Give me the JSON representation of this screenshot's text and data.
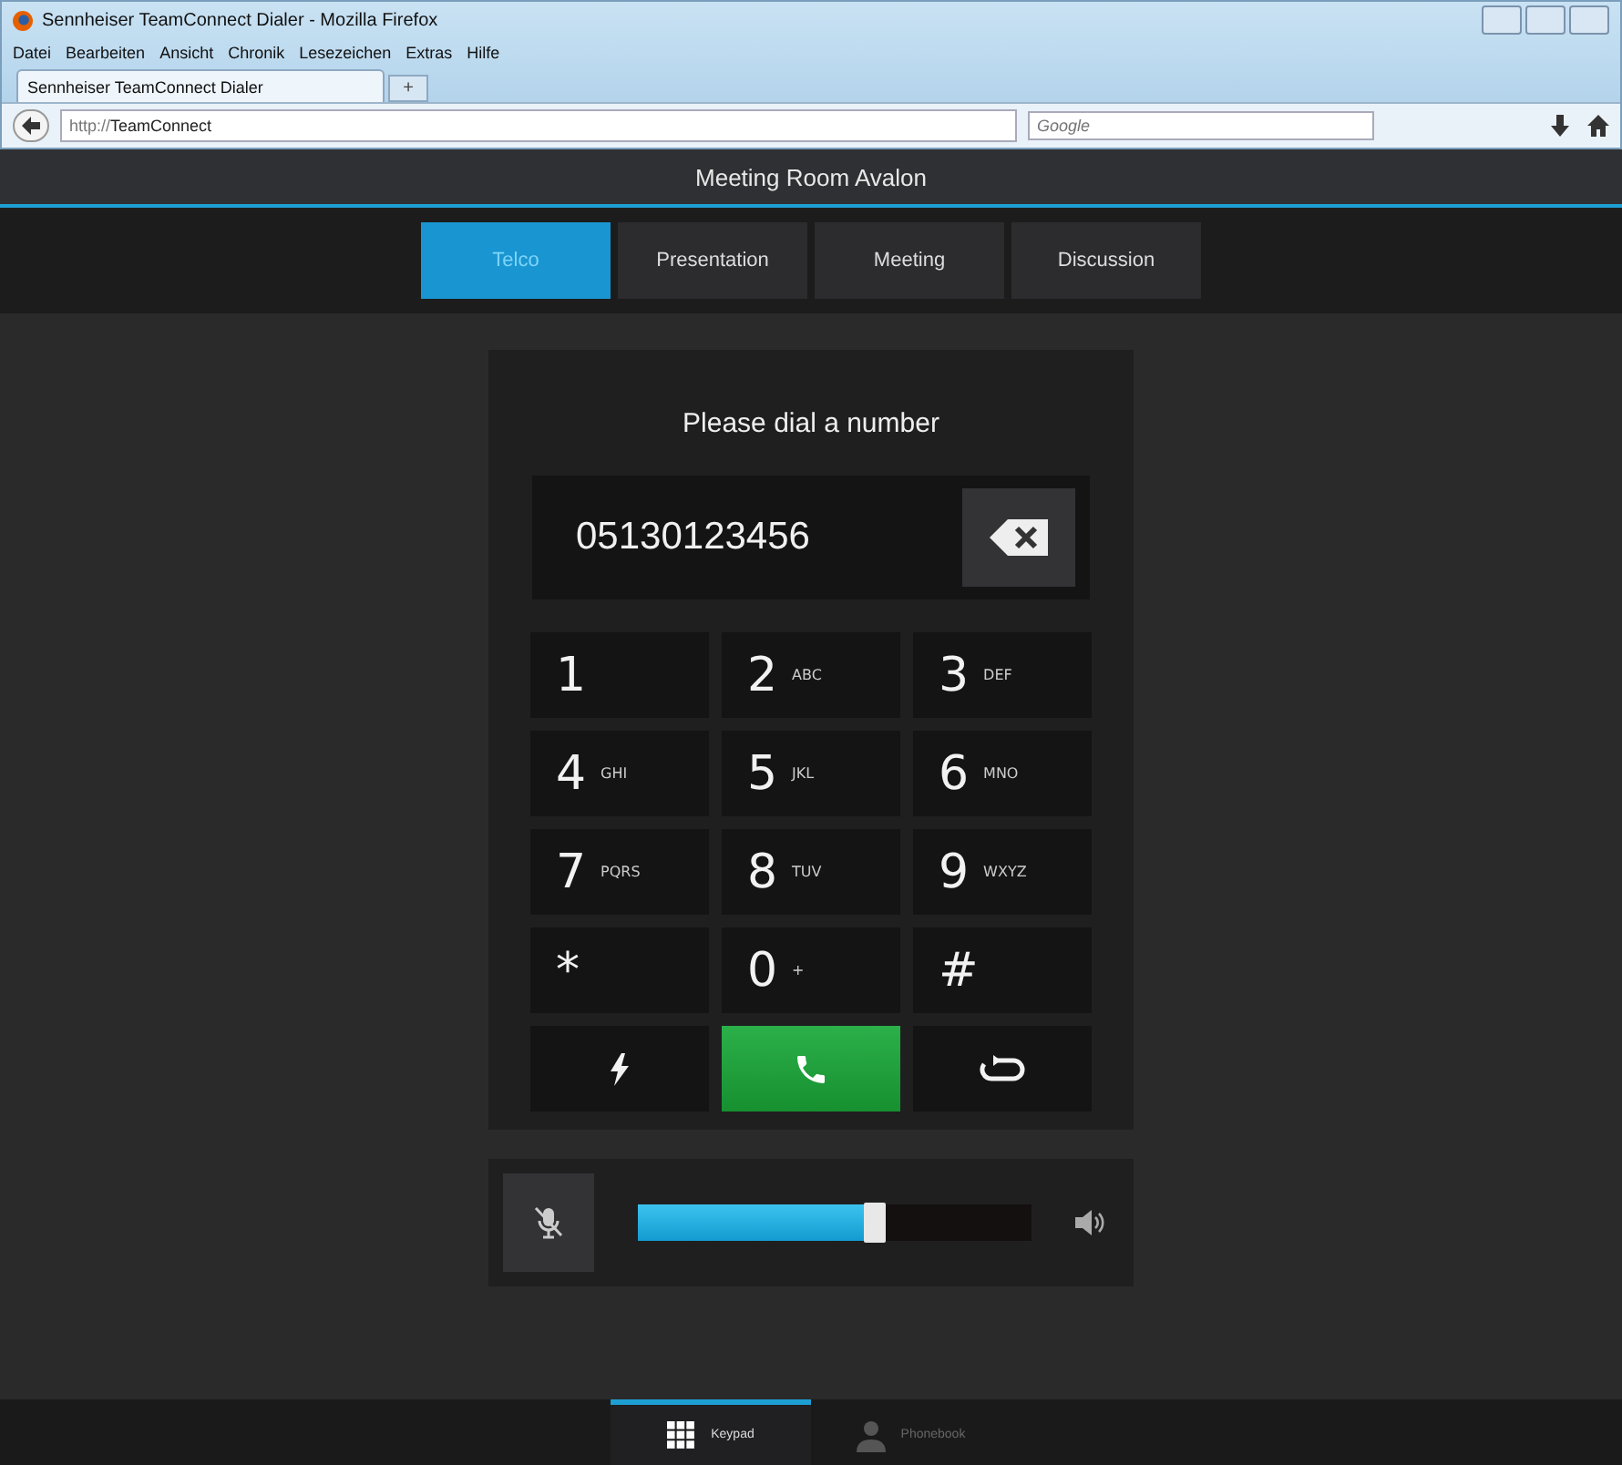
{
  "window": {
    "title": "Sennheiser TeamConnect Dialer - Mozilla Firefox"
  },
  "menu": [
    "Datei",
    "Bearbeiten",
    "Ansicht",
    "Chronik",
    "Lesezeichen",
    "Extras",
    "Hilfe"
  ],
  "browser_tab": {
    "title": "Sennheiser TeamConnect Dialer",
    "new_tab": "+"
  },
  "address_bar": {
    "url_prefix": "http://",
    "url_host": "TeamConnect"
  },
  "search": {
    "placeholder": "Google"
  },
  "header": {
    "title": "Meeting Room Avalon"
  },
  "mode_tabs": [
    {
      "label": "Telco",
      "selected": true
    },
    {
      "label": "Presentation",
      "selected": false
    },
    {
      "label": "Meeting",
      "selected": false
    },
    {
      "label": "Discussion",
      "selected": false
    }
  ],
  "dialer": {
    "prompt": "Please dial a number",
    "number": "05130123456",
    "keys": [
      {
        "kind": "digit",
        "digit": "1"
      },
      {
        "kind": "digit",
        "digit": "2",
        "letters": "ABC"
      },
      {
        "kind": "digit",
        "digit": "3",
        "letters": "DEF"
      },
      {
        "kind": "digit",
        "digit": "4",
        "letters": "GHI"
      },
      {
        "kind": "digit",
        "digit": "5",
        "letters": "JKL"
      },
      {
        "kind": "digit",
        "digit": "6",
        "letters": "MNO"
      },
      {
        "kind": "digit",
        "digit": "7",
        "letters": "PQRS"
      },
      {
        "kind": "digit",
        "digit": "8",
        "letters": "TUV"
      },
      {
        "kind": "digit",
        "digit": "9",
        "letters": "WXYZ"
      },
      {
        "kind": "symbol",
        "digit": "*"
      },
      {
        "kind": "digit",
        "digit": "0",
        "letters": "+"
      },
      {
        "kind": "symbol",
        "digit": "#"
      },
      {
        "kind": "flash"
      },
      {
        "kind": "call"
      },
      {
        "kind": "redial"
      }
    ]
  },
  "volume": {
    "level": 0.63
  },
  "bottom_tabs": [
    {
      "label": "Keypad",
      "kind": "keypad",
      "selected": true
    },
    {
      "label": "Phonebook",
      "kind": "phonebook",
      "selected": false
    }
  ]
}
